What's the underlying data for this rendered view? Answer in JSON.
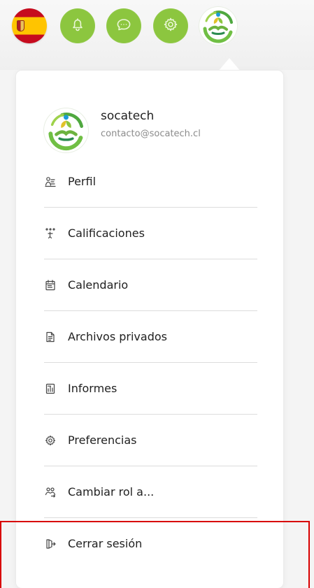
{
  "header": {
    "language_flag": "spain-flag-icon",
    "action_icons": [
      "bell-icon",
      "chat-icon",
      "gear-icon"
    ],
    "account_avatar": "socatech-logo-icon",
    "icon_color": "#8cc63f"
  },
  "user": {
    "name": "socatech",
    "email": "contacto@socatech.cl"
  },
  "menu": {
    "items": [
      {
        "label": "Perfil",
        "icon": "profile-icon"
      },
      {
        "label": "Calificaciones",
        "icon": "grades-icon"
      },
      {
        "label": "Calendario",
        "icon": "calendar-icon"
      },
      {
        "label": "Archivos privados",
        "icon": "private-files-icon"
      },
      {
        "label": "Informes",
        "icon": "reports-icon"
      },
      {
        "label": "Preferencias",
        "icon": "preferences-icon"
      },
      {
        "label": "Cambiar rol a...",
        "icon": "switch-role-icon"
      },
      {
        "label": "Cerrar sesión",
        "icon": "logout-icon"
      }
    ]
  },
  "highlight": {
    "target": "Cerrar sesión",
    "color": "#d80000"
  }
}
